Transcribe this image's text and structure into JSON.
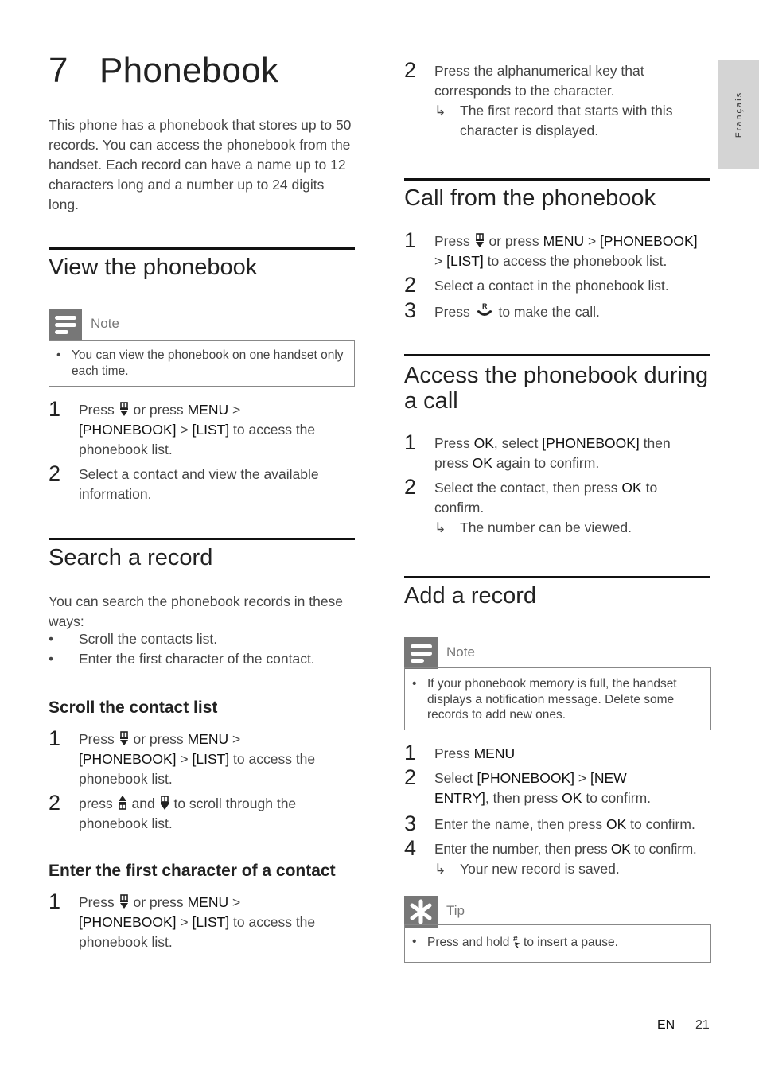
{
  "chapter": {
    "number": "7",
    "title": "Phonebook",
    "intro": "This phone has a phonebook that stores up to 50 records. You can access the phonebook from the handset. Each record can have a name up to 12 characters long and a number up to 24 digits long."
  },
  "sections": {
    "view": {
      "title": "View the phonebook",
      "note_label": "Note",
      "note_text": "You can view the phonebook on one handset only each time.",
      "steps": [
        {
          "num": "1",
          "pre": "Press",
          "mid": " or press ",
          "b1": "MENU",
          "s1": " >",
          "b2": "[PHONEBOOK]",
          "s2": " > ",
          "b3": "[LIST]",
          "s3": " to access the",
          "line3": "phonebook list."
        },
        {
          "num": "2",
          "line1": "Select a contact and view the available",
          "line2": "information."
        }
      ]
    },
    "search": {
      "title": "Search a record",
      "intro_l1": "You can search the phonebook records in these",
      "intro_l2": "ways:",
      "bullets": [
        "Scroll the contacts list.",
        "Enter the first character of the contact."
      ],
      "scroll": {
        "title": "Scroll the contact list",
        "steps": [
          {
            "num": "1",
            "pre": "Press",
            "mid": " or press ",
            "b1": "MENU",
            "s1": " >",
            "b2": "[PHONEBOOK]",
            "s2": " > ",
            "b3": "[LIST]",
            "s3": " to access the",
            "line3": "phonebook list."
          },
          {
            "num": "2",
            "pre": "press",
            "and": " and ",
            "post": " to scroll through the",
            "line2": "phonebook list."
          }
        ]
      },
      "first_char": {
        "title": "Enter the first character of a contact",
        "steps": [
          {
            "num": "1",
            "pre": "Press",
            "mid": " or press ",
            "b1": "MENU",
            "s1": " >",
            "b2": "[PHONEBOOK]",
            "s2": " > ",
            "b3": "[LIST]",
            "s3": " to access the",
            "line3": "phonebook list."
          },
          {
            "num": "2",
            "line1": "Press the alphanumerical key that",
            "line2": "corresponds to the character.",
            "result_l1": "The first record that starts with this",
            "result_l2": "character is displayed."
          }
        ]
      }
    },
    "call": {
      "title": "Call from the phonebook",
      "steps": [
        {
          "num": "1",
          "pre": "Press",
          "mid": " or press ",
          "b1": "MENU",
          "s1": " > ",
          "b2": "[PHONEBOOK]",
          "s2": "> ",
          "b3": "[LIST]",
          "s3": " to access the phonebook list."
        },
        {
          "num": "2",
          "line1": "Select a contact in the phonebook list."
        },
        {
          "num": "3",
          "pre": "Press",
          "post": " to make the call."
        }
      ]
    },
    "during_call": {
      "title_l1": "Access the phonebook during",
      "title_l2": "a call",
      "steps": [
        {
          "num": "1",
          "pre": "Press ",
          "b1": "OK",
          "mid": ", select ",
          "b2": "[PHONEBOOK]",
          "post": " then",
          "l2pre": "press ",
          "b3": "OK",
          "l2post": " again to confirm."
        },
        {
          "num": "2",
          "pre": "Select the contact, then press ",
          "b1": "OK",
          "post": " to",
          "line2": "confirm.",
          "result": "The number can be viewed."
        }
      ]
    },
    "add": {
      "title": "Add a record",
      "note_label": "Note",
      "note_l1": "If your phonebook memory is full, the handset",
      "note_l2": "displays a notification message. Delete some",
      "note_l3": "records to add new ones.",
      "steps": [
        {
          "num": "1",
          "pre": "Press ",
          "b1": "MENU"
        },
        {
          "num": "2",
          "pre": "Select ",
          "b1": "[PHONEBOOK]",
          "mid": " > ",
          "b2": "[NEW",
          "b3": "ENTRY]",
          "post": ", then press ",
          "b4": "OK",
          "end": " to confirm."
        },
        {
          "num": "3",
          "pre": "Enter the name, then press ",
          "b1": "OK",
          "post": " to confirm."
        },
        {
          "num": "4",
          "pre": "Enter the number, then press ",
          "b1": "OK",
          "post": " to confirm.",
          "result": "Your new record is saved."
        }
      ],
      "tip_label": "Tip",
      "tip_pre": "Press and hold ",
      "tip_post": " to insert a pause."
    }
  },
  "side_tab": "Français",
  "footer": {
    "lang": "EN",
    "page": "21"
  },
  "symbols": {
    "bullet": "•",
    "arrow": "↳"
  }
}
